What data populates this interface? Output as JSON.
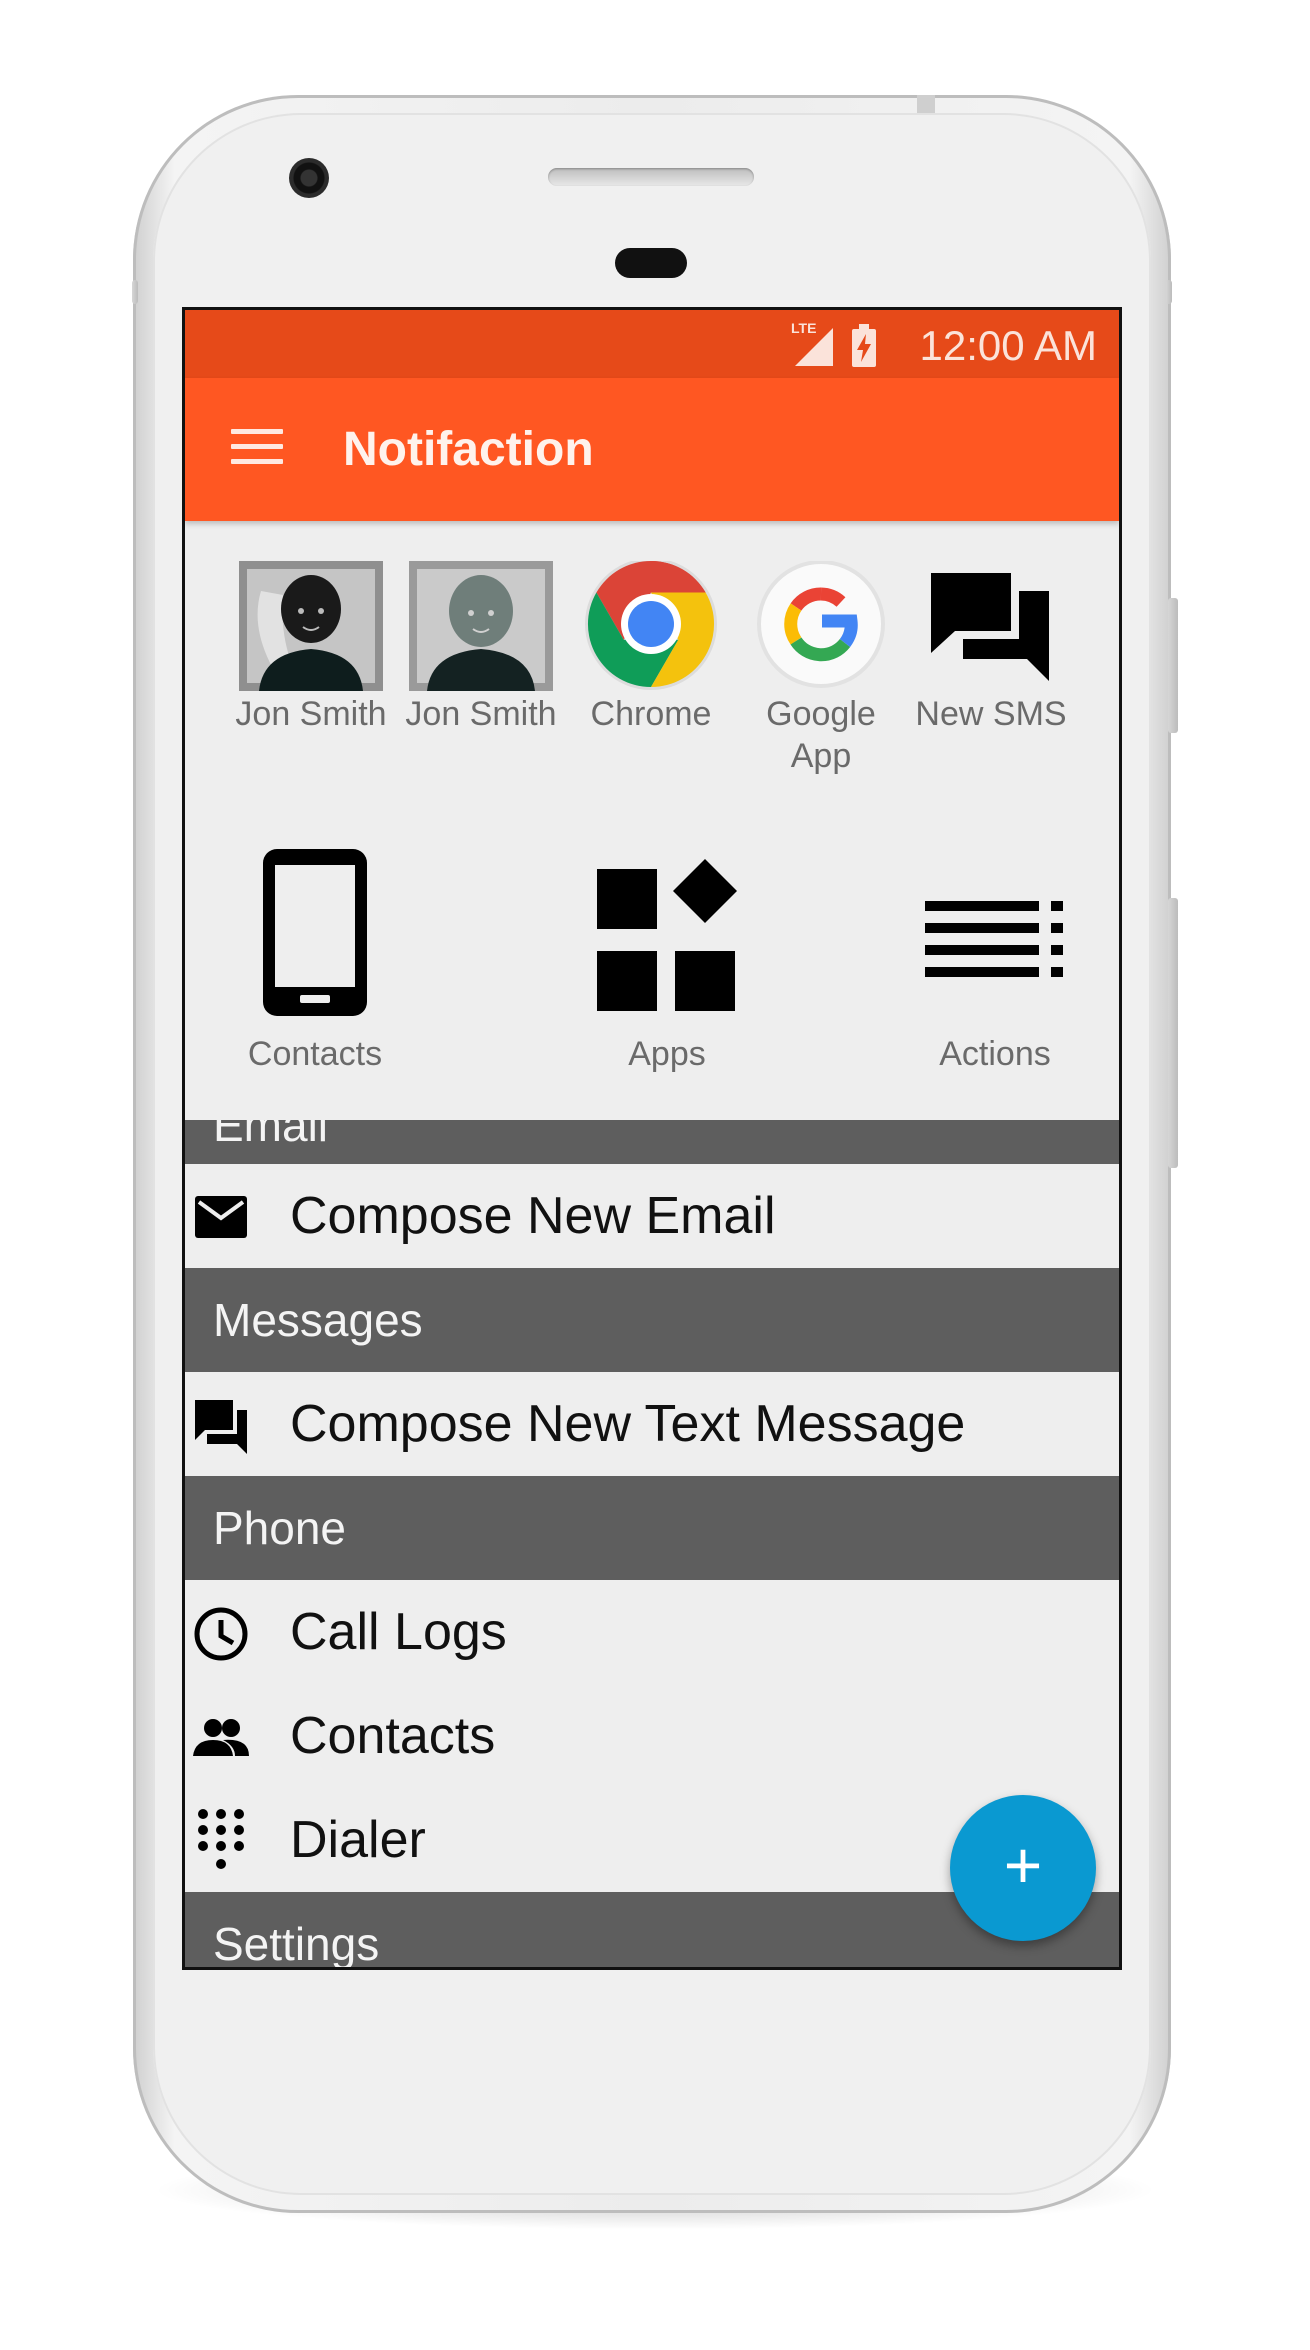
{
  "status_bar": {
    "network": "LTE",
    "time": "12:00 AM"
  },
  "app_bar": {
    "title": "Notifaction",
    "menu_icon": "hamburger-menu-icon"
  },
  "shortcuts": [
    {
      "label": "Jon Smith",
      "icon": "contact-avatar"
    },
    {
      "label": "Jon Smith",
      "icon": "contact-avatar"
    },
    {
      "label": "Chrome",
      "icon": "chrome-logo"
    },
    {
      "label": "Google App",
      "icon": "google-logo"
    },
    {
      "label": "New SMS",
      "icon": "chat-bubbles-icon"
    }
  ],
  "categories": [
    {
      "label": "Contacts",
      "icon": "smartphone-icon"
    },
    {
      "label": "Apps",
      "icon": "widgets-icon"
    },
    {
      "label": "Actions",
      "icon": "list-actions-icon"
    }
  ],
  "list": {
    "email_header": "Email",
    "compose_email": "Compose New Email",
    "messages_header": "Messages",
    "compose_text": "Compose New Text Message",
    "phone_header": "Phone",
    "call_logs": "Call Logs",
    "contacts": "Contacts",
    "dialer": "Dialer",
    "settings_header": "Settings"
  },
  "fab": {
    "label": "+"
  },
  "colors": {
    "status_bar": "#e64a19",
    "app_bar": "#ff5722",
    "section_header": "#5e5e5e",
    "fab": "#0a99d1"
  }
}
